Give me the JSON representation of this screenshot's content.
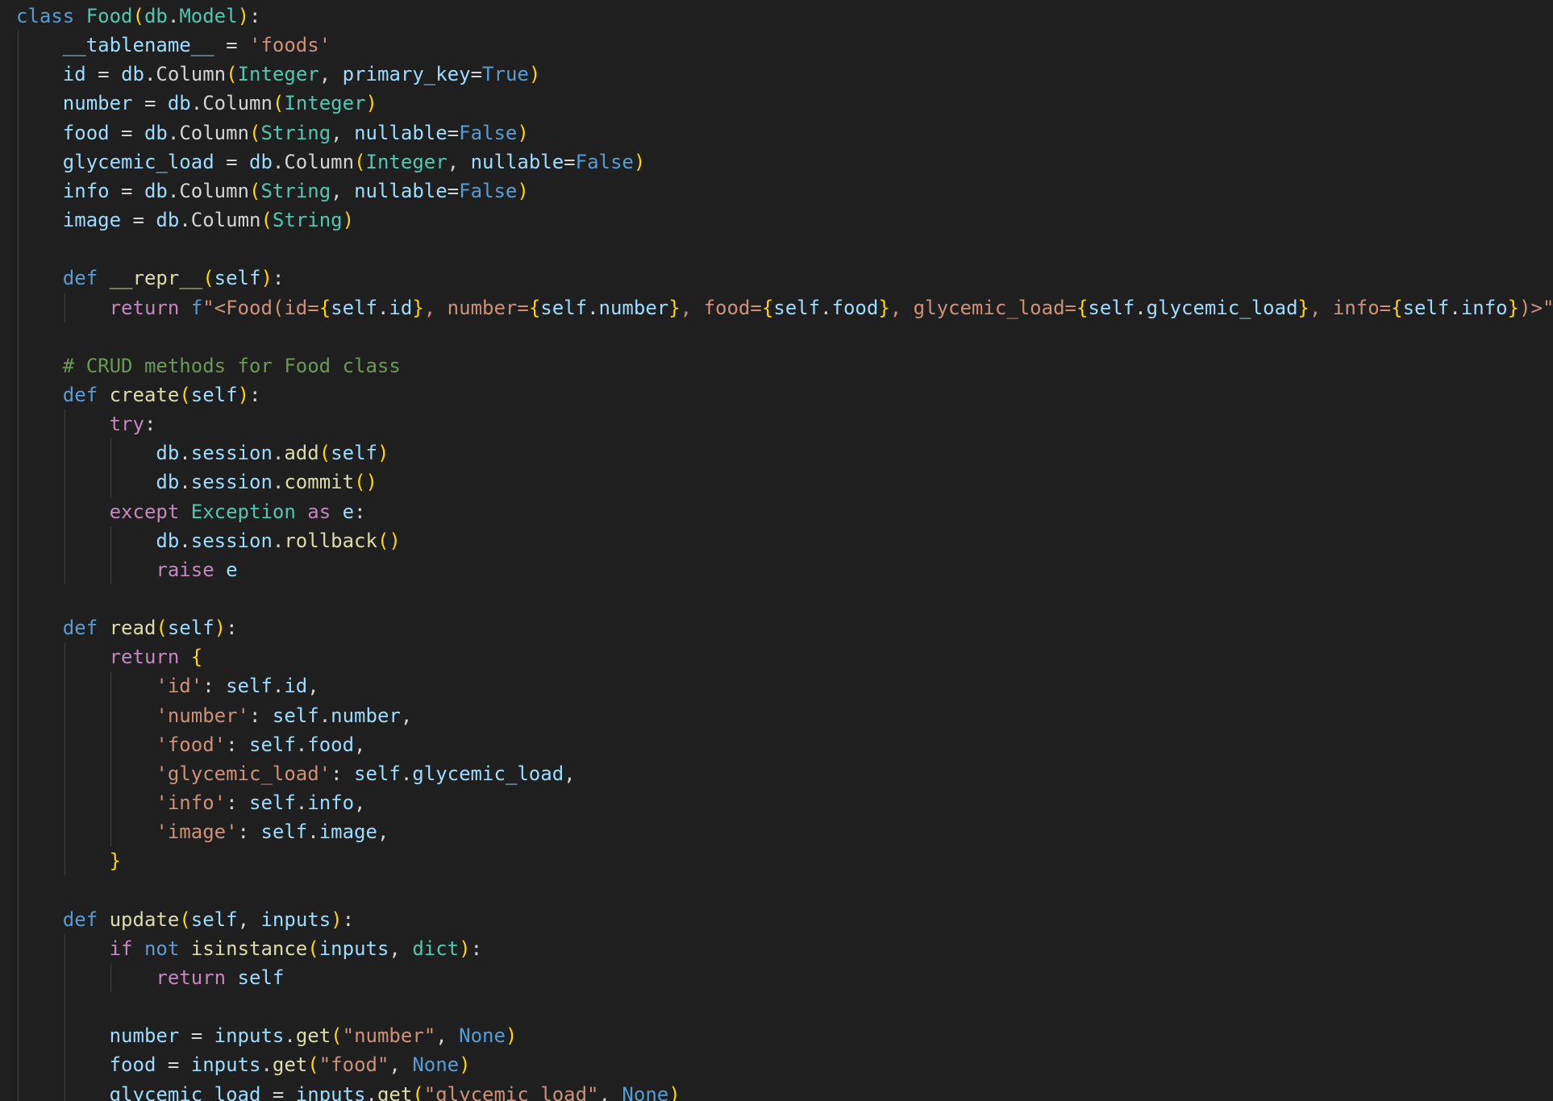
{
  "editor": {
    "language": "python",
    "theme": {
      "background": "#1f1f1f",
      "keyword": "#569cd6",
      "control": "#c586c0",
      "class": "#4ec9b0",
      "function": "#dcdcaa",
      "variable": "#9cdcfe",
      "string": "#ce9178",
      "comment": "#6a9955",
      "bracket": "#ffd700"
    },
    "lines": [
      [
        [
          "kw",
          "class"
        ],
        [
          "plain",
          " "
        ],
        [
          "cls",
          "Food"
        ],
        [
          "br1",
          "("
        ],
        [
          "cls",
          "db"
        ],
        [
          "op",
          "."
        ],
        [
          "cls",
          "Model"
        ],
        [
          "br1",
          ")"
        ],
        [
          "op",
          ":"
        ]
      ],
      [
        [
          "plain",
          "    "
        ],
        [
          "var",
          "__tablename__"
        ],
        [
          "op",
          " = "
        ],
        [
          "str",
          "'foods'"
        ]
      ],
      [
        [
          "plain",
          "    "
        ],
        [
          "var",
          "id"
        ],
        [
          "op",
          " = "
        ],
        [
          "var",
          "db"
        ],
        [
          "op",
          "."
        ],
        [
          "plain",
          "Column"
        ],
        [
          "br1",
          "("
        ],
        [
          "cls",
          "Integer"
        ],
        [
          "op",
          ", "
        ],
        [
          "var",
          "primary_key"
        ],
        [
          "op",
          "="
        ],
        [
          "kw",
          "True"
        ],
        [
          "br1",
          ")"
        ]
      ],
      [
        [
          "plain",
          "    "
        ],
        [
          "var",
          "number"
        ],
        [
          "op",
          " = "
        ],
        [
          "var",
          "db"
        ],
        [
          "op",
          "."
        ],
        [
          "plain",
          "Column"
        ],
        [
          "br1",
          "("
        ],
        [
          "cls",
          "Integer"
        ],
        [
          "br1",
          ")"
        ]
      ],
      [
        [
          "plain",
          "    "
        ],
        [
          "var",
          "food"
        ],
        [
          "op",
          " = "
        ],
        [
          "var",
          "db"
        ],
        [
          "op",
          "."
        ],
        [
          "plain",
          "Column"
        ],
        [
          "br1",
          "("
        ],
        [
          "cls",
          "String"
        ],
        [
          "op",
          ", "
        ],
        [
          "var",
          "nullable"
        ],
        [
          "op",
          "="
        ],
        [
          "kw",
          "False"
        ],
        [
          "br1",
          ")"
        ]
      ],
      [
        [
          "plain",
          "    "
        ],
        [
          "var",
          "glycemic_load"
        ],
        [
          "op",
          " = "
        ],
        [
          "var",
          "db"
        ],
        [
          "op",
          "."
        ],
        [
          "plain",
          "Column"
        ],
        [
          "br1",
          "("
        ],
        [
          "cls",
          "Integer"
        ],
        [
          "op",
          ", "
        ],
        [
          "var",
          "nullable"
        ],
        [
          "op",
          "="
        ],
        [
          "kw",
          "False"
        ],
        [
          "br1",
          ")"
        ]
      ],
      [
        [
          "plain",
          "    "
        ],
        [
          "var",
          "info"
        ],
        [
          "op",
          " = "
        ],
        [
          "var",
          "db"
        ],
        [
          "op",
          "."
        ],
        [
          "plain",
          "Column"
        ],
        [
          "br1",
          "("
        ],
        [
          "cls",
          "String"
        ],
        [
          "op",
          ", "
        ],
        [
          "var",
          "nullable"
        ],
        [
          "op",
          "="
        ],
        [
          "kw",
          "False"
        ],
        [
          "br1",
          ")"
        ]
      ],
      [
        [
          "plain",
          "    "
        ],
        [
          "var",
          "image"
        ],
        [
          "op",
          " = "
        ],
        [
          "var",
          "db"
        ],
        [
          "op",
          "."
        ],
        [
          "plain",
          "Column"
        ],
        [
          "br1",
          "("
        ],
        [
          "cls",
          "String"
        ],
        [
          "br1",
          ")"
        ]
      ],
      [],
      [
        [
          "plain",
          "    "
        ],
        [
          "kw",
          "def"
        ],
        [
          "plain",
          " "
        ],
        [
          "fn",
          "__repr__"
        ],
        [
          "br1",
          "("
        ],
        [
          "var",
          "self"
        ],
        [
          "br1",
          ")"
        ],
        [
          "op",
          ":"
        ]
      ],
      [
        [
          "plain",
          "        "
        ],
        [
          "ctl",
          "return"
        ],
        [
          "plain",
          " "
        ],
        [
          "kw",
          "f"
        ],
        [
          "str",
          "\"<Food(id="
        ],
        [
          "br1",
          "{"
        ],
        [
          "var",
          "self"
        ],
        [
          "op",
          "."
        ],
        [
          "var",
          "id"
        ],
        [
          "br1",
          "}"
        ],
        [
          "str",
          ", number="
        ],
        [
          "br1",
          "{"
        ],
        [
          "var",
          "self"
        ],
        [
          "op",
          "."
        ],
        [
          "var",
          "number"
        ],
        [
          "br1",
          "}"
        ],
        [
          "str",
          ", food="
        ],
        [
          "br1",
          "{"
        ],
        [
          "var",
          "self"
        ],
        [
          "op",
          "."
        ],
        [
          "var",
          "food"
        ],
        [
          "br1",
          "}"
        ],
        [
          "str",
          ", glycemic_load="
        ],
        [
          "br1",
          "{"
        ],
        [
          "var",
          "self"
        ],
        [
          "op",
          "."
        ],
        [
          "var",
          "glycemic_load"
        ],
        [
          "br1",
          "}"
        ],
        [
          "str",
          ", info="
        ],
        [
          "br1",
          "{"
        ],
        [
          "var",
          "self"
        ],
        [
          "op",
          "."
        ],
        [
          "var",
          "info"
        ],
        [
          "br1",
          "}"
        ],
        [
          "str",
          ")>\""
        ]
      ],
      [],
      [
        [
          "plain",
          "    "
        ],
        [
          "cmt",
          "# CRUD methods for Food class"
        ]
      ],
      [
        [
          "plain",
          "    "
        ],
        [
          "kw",
          "def"
        ],
        [
          "plain",
          " "
        ],
        [
          "fn",
          "create"
        ],
        [
          "br1",
          "("
        ],
        [
          "var",
          "self"
        ],
        [
          "br1",
          ")"
        ],
        [
          "op",
          ":"
        ]
      ],
      [
        [
          "plain",
          "        "
        ],
        [
          "ctl",
          "try"
        ],
        [
          "op",
          ":"
        ]
      ],
      [
        [
          "plain",
          "            "
        ],
        [
          "var",
          "db"
        ],
        [
          "op",
          "."
        ],
        [
          "var",
          "session"
        ],
        [
          "op",
          "."
        ],
        [
          "fn",
          "add"
        ],
        [
          "br1",
          "("
        ],
        [
          "var",
          "self"
        ],
        [
          "br1",
          ")"
        ]
      ],
      [
        [
          "plain",
          "            "
        ],
        [
          "var",
          "db"
        ],
        [
          "op",
          "."
        ],
        [
          "var",
          "session"
        ],
        [
          "op",
          "."
        ],
        [
          "fn",
          "commit"
        ],
        [
          "br1",
          "()"
        ]
      ],
      [
        [
          "plain",
          "        "
        ],
        [
          "ctl",
          "except"
        ],
        [
          "plain",
          " "
        ],
        [
          "cls",
          "Exception"
        ],
        [
          "plain",
          " "
        ],
        [
          "ctl",
          "as"
        ],
        [
          "plain",
          " "
        ],
        [
          "var",
          "e"
        ],
        [
          "op",
          ":"
        ]
      ],
      [
        [
          "plain",
          "            "
        ],
        [
          "var",
          "db"
        ],
        [
          "op",
          "."
        ],
        [
          "var",
          "session"
        ],
        [
          "op",
          "."
        ],
        [
          "fn",
          "rollback"
        ],
        [
          "br1",
          "()"
        ]
      ],
      [
        [
          "plain",
          "            "
        ],
        [
          "ctl",
          "raise"
        ],
        [
          "plain",
          " "
        ],
        [
          "var",
          "e"
        ]
      ],
      [],
      [
        [
          "plain",
          "    "
        ],
        [
          "kw",
          "def"
        ],
        [
          "plain",
          " "
        ],
        [
          "fn",
          "read"
        ],
        [
          "br1",
          "("
        ],
        [
          "var",
          "self"
        ],
        [
          "br1",
          ")"
        ],
        [
          "op",
          ":"
        ]
      ],
      [
        [
          "plain",
          "        "
        ],
        [
          "ctl",
          "return"
        ],
        [
          "plain",
          " "
        ],
        [
          "br1",
          "{"
        ]
      ],
      [
        [
          "plain",
          "            "
        ],
        [
          "str",
          "'id'"
        ],
        [
          "op",
          ": "
        ],
        [
          "var",
          "self"
        ],
        [
          "op",
          "."
        ],
        [
          "var",
          "id"
        ],
        [
          "op",
          ","
        ]
      ],
      [
        [
          "plain",
          "            "
        ],
        [
          "str",
          "'number'"
        ],
        [
          "op",
          ": "
        ],
        [
          "var",
          "self"
        ],
        [
          "op",
          "."
        ],
        [
          "var",
          "number"
        ],
        [
          "op",
          ","
        ]
      ],
      [
        [
          "plain",
          "            "
        ],
        [
          "str",
          "'food'"
        ],
        [
          "op",
          ": "
        ],
        [
          "var",
          "self"
        ],
        [
          "op",
          "."
        ],
        [
          "var",
          "food"
        ],
        [
          "op",
          ","
        ]
      ],
      [
        [
          "plain",
          "            "
        ],
        [
          "str",
          "'glycemic_load'"
        ],
        [
          "op",
          ": "
        ],
        [
          "var",
          "self"
        ],
        [
          "op",
          "."
        ],
        [
          "var",
          "glycemic_load"
        ],
        [
          "op",
          ","
        ]
      ],
      [
        [
          "plain",
          "            "
        ],
        [
          "str",
          "'info'"
        ],
        [
          "op",
          ": "
        ],
        [
          "var",
          "self"
        ],
        [
          "op",
          "."
        ],
        [
          "var",
          "info"
        ],
        [
          "op",
          ","
        ]
      ],
      [
        [
          "plain",
          "            "
        ],
        [
          "str",
          "'image'"
        ],
        [
          "op",
          ": "
        ],
        [
          "var",
          "self"
        ],
        [
          "op",
          "."
        ],
        [
          "var",
          "image"
        ],
        [
          "op",
          ","
        ]
      ],
      [
        [
          "plain",
          "        "
        ],
        [
          "br1",
          "}"
        ]
      ],
      [],
      [
        [
          "plain",
          "    "
        ],
        [
          "kw",
          "def"
        ],
        [
          "plain",
          " "
        ],
        [
          "fn",
          "update"
        ],
        [
          "br1",
          "("
        ],
        [
          "var",
          "self"
        ],
        [
          "op",
          ", "
        ],
        [
          "var",
          "inputs"
        ],
        [
          "br1",
          ")"
        ],
        [
          "op",
          ":"
        ]
      ],
      [
        [
          "plain",
          "        "
        ],
        [
          "ctl",
          "if"
        ],
        [
          "plain",
          " "
        ],
        [
          "kw",
          "not"
        ],
        [
          "plain",
          " "
        ],
        [
          "fn",
          "isinstance"
        ],
        [
          "br1",
          "("
        ],
        [
          "var",
          "inputs"
        ],
        [
          "op",
          ", "
        ],
        [
          "cls",
          "dict"
        ],
        [
          "br1",
          ")"
        ],
        [
          "op",
          ":"
        ]
      ],
      [
        [
          "plain",
          "            "
        ],
        [
          "ctl",
          "return"
        ],
        [
          "plain",
          " "
        ],
        [
          "var",
          "self"
        ]
      ],
      [],
      [
        [
          "plain",
          "        "
        ],
        [
          "var",
          "number"
        ],
        [
          "op",
          " = "
        ],
        [
          "var",
          "inputs"
        ],
        [
          "op",
          "."
        ],
        [
          "fn",
          "get"
        ],
        [
          "br1",
          "("
        ],
        [
          "str",
          "\"number\""
        ],
        [
          "op",
          ", "
        ],
        [
          "kw",
          "None"
        ],
        [
          "br1",
          ")"
        ]
      ],
      [
        [
          "plain",
          "        "
        ],
        [
          "var",
          "food"
        ],
        [
          "op",
          " = "
        ],
        [
          "var",
          "inputs"
        ],
        [
          "op",
          "."
        ],
        [
          "fn",
          "get"
        ],
        [
          "br1",
          "("
        ],
        [
          "str",
          "\"food\""
        ],
        [
          "op",
          ", "
        ],
        [
          "kw",
          "None"
        ],
        [
          "br1",
          ")"
        ]
      ],
      [
        [
          "plain",
          "        "
        ],
        [
          "var",
          "glycemic_load"
        ],
        [
          "op",
          " = "
        ],
        [
          "var",
          "inputs"
        ],
        [
          "op",
          "."
        ],
        [
          "fn",
          "get"
        ],
        [
          "br1",
          "("
        ],
        [
          "str",
          "\"glycemic_load\""
        ],
        [
          "op",
          ", "
        ],
        [
          "kw",
          "None"
        ],
        [
          "br1",
          ")"
        ]
      ]
    ]
  }
}
